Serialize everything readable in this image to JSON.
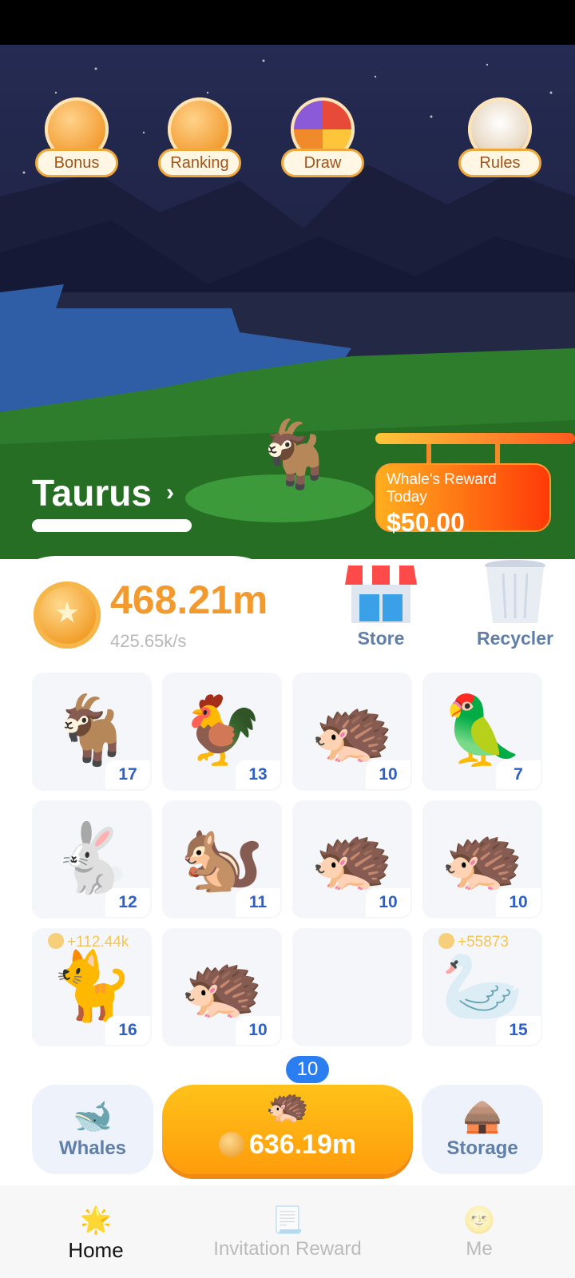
{
  "top_buttons": [
    {
      "label": "Bonus",
      "icon": "coin-icon"
    },
    {
      "label": "Ranking",
      "icon": "trophy-icon"
    },
    {
      "label": "Draw",
      "icon": "wheel-icon"
    },
    {
      "label": "Rules",
      "icon": "book-icon"
    }
  ],
  "zodiac": {
    "name": "Taurus",
    "arrow": "›"
  },
  "reward": {
    "title": "Whale's Reward Today",
    "amount": "$50.00"
  },
  "balance": {
    "amount": "468.21m",
    "rate": "425.65k/s"
  },
  "store_label": "Store",
  "recycler_label": "Recycler",
  "grid": [
    {
      "emoji": "🐐",
      "level": "17",
      "earning": ""
    },
    {
      "emoji": "🐓",
      "level": "13",
      "earning": ""
    },
    {
      "emoji": "🦔",
      "level": "10",
      "earning": ""
    },
    {
      "emoji": "🦜",
      "level": "7",
      "earning": ""
    },
    {
      "emoji": "🐇",
      "level": "12",
      "earning": ""
    },
    {
      "emoji": "🐿️",
      "level": "11",
      "earning": ""
    },
    {
      "emoji": "🦔",
      "level": "10",
      "earning": ""
    },
    {
      "emoji": "🦔",
      "level": "10",
      "earning": ""
    },
    {
      "emoji": "🐈",
      "level": "16",
      "earning": "+112.44k"
    },
    {
      "emoji": "🦔",
      "level": "10",
      "earning": ""
    },
    {
      "emoji": "",
      "level": "",
      "earning": ""
    },
    {
      "emoji": "🦢",
      "level": "15",
      "earning": "+55873"
    }
  ],
  "whales_label": "Whales",
  "storage_label": "Storage",
  "buy": {
    "badge": "10",
    "price": "636.19m",
    "animal": "🦔"
  },
  "nav": [
    {
      "label": "Home",
      "icon": "🌟"
    },
    {
      "label": "Invitation Reward",
      "icon": "📃"
    },
    {
      "label": "Me",
      "icon": "🌝"
    }
  ],
  "colors": {
    "accent": "#f29a2e",
    "level_blue": "#2e5fc5",
    "label_blue": "#5f7ea8"
  }
}
